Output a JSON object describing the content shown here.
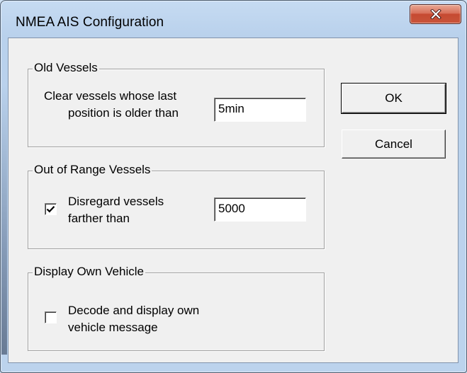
{
  "window": {
    "title": "NMEA AIS Configuration",
    "close_icon": "close-icon"
  },
  "old_vessels": {
    "legend": "Old Vessels",
    "label_line1": "Clear vessels whose last",
    "label_line2": "position is older than",
    "value": "5min"
  },
  "out_of_range": {
    "legend": "Out of Range Vessels",
    "checkbox_checked": true,
    "label_line1": "Disregard vessels",
    "label_line2": "farther than",
    "value": "5000"
  },
  "own_vehicle": {
    "legend": "Display Own Vehicle",
    "checkbox_checked": false,
    "label_line1": "Decode and display own",
    "label_line2": "vehicle message"
  },
  "buttons": {
    "ok": "OK",
    "cancel": "Cancel"
  }
}
